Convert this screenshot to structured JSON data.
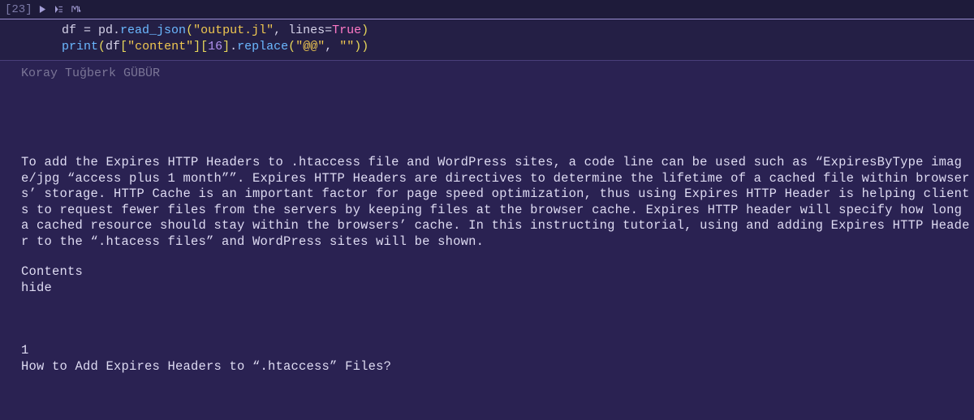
{
  "cell": {
    "prompt": "[23]"
  },
  "code": {
    "l1": {
      "t0": "df ",
      "t1": "= ",
      "t2": "pd.",
      "t3": "read_json",
      "t4": "(",
      "t5": "\"output.jl\"",
      "t6": ", ",
      "t7": "lines",
      "t8": "=",
      "t9": "True",
      "t10": ")"
    },
    "l2": {
      "t0": "print",
      "t1": "(",
      "t2": "df",
      "t3": "[",
      "t4": "\"content\"",
      "t5": "]",
      "t6": "[",
      "t7": "16",
      "t8": "]",
      "t9": ".",
      "t10": "replace",
      "t11": "(",
      "t12": "\"@@\"",
      "t13": ", ",
      "t14": "\"\"",
      "t15": ")",
      "t16": ")"
    }
  },
  "output": {
    "fragment": "Koray Tuğberk GÜBÜR",
    "paragraph": "To add the Expires HTTP Headers to .htaccess file and WordPress sites, a code line can be used such as “ExpiresByType image/jpg “access plus 1 month””. Expires HTTP Headers are directives to determine the lifetime of a cached file within browsers’ storage. HTTP Cache is an important factor for page speed optimization, thus using Expires HTTP Header is helping clients to request fewer files from the servers by keeping files at the browser cache. Expires HTTP header will specify how long a cached resource should stay within the browsers’ cache. In this instructing tutorial, using and adding Expires HTTP Header to the “.htacess files” and WordPress sites will be shown.",
    "contents_label": "Contents",
    "hide_label": "hide",
    "section_number": "1",
    "section_title": "How to Add Expires Headers to “.htaccess” Files?"
  }
}
